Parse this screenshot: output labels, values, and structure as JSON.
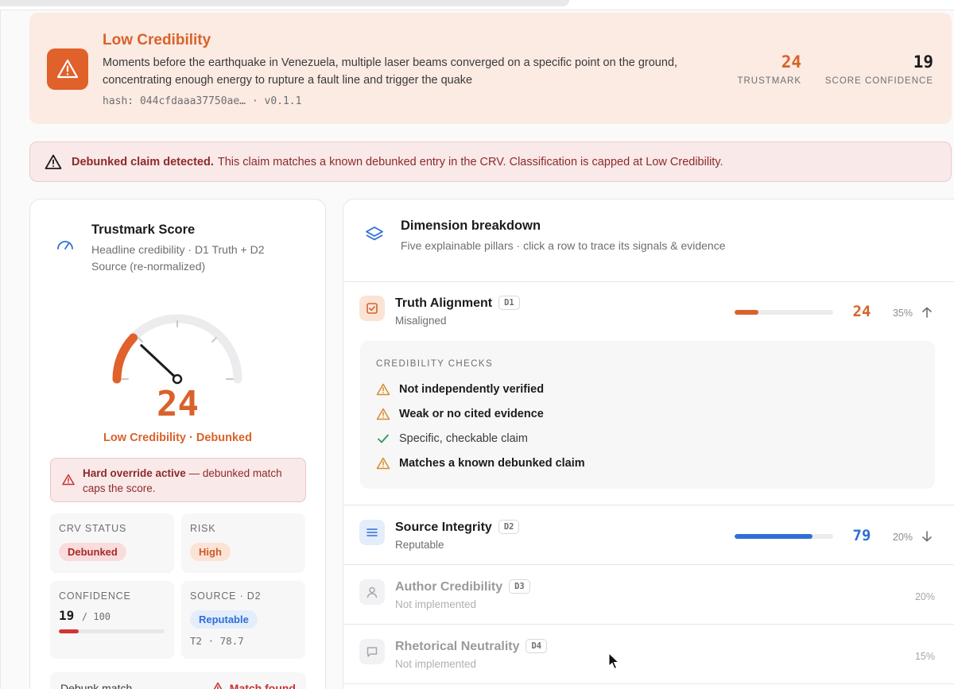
{
  "header": {
    "classification": "Low Credibility",
    "claim_text": "Moments before the earthquake in Venezuela, multiple laser beams converged on a specific point on the ground, concentrating enough energy to rupture a fault line and trigger the quake",
    "hash_line": "hash: 044cfdaaa37750ae… · v0.1.1",
    "trustmark_value": "24",
    "trustmark_label": "TRUSTMARK",
    "confidence_value": "19",
    "confidence_label": "SCORE CONFIDENCE"
  },
  "banner": {
    "bold": "Debunked claim detected.",
    "text": "This claim matches a known debunked entry in the CRV. Classification is capped at Low Credibility."
  },
  "score_panel": {
    "title": "Trustmark Score",
    "subtitle": "Headline credibility · D1 Truth + D2 Source (re-normalized)",
    "score": "24",
    "score_fraction": 0.24,
    "caption": "Low Credibility · Debunked",
    "override_bold": "Hard override active",
    "override_text": " — debunked match caps the score.",
    "crv_label": "CRV STATUS",
    "crv_value": "Debunked",
    "risk_label": "RISK",
    "risk_value": "High",
    "confidence_label": "CONFIDENCE",
    "confidence_value": "19",
    "confidence_denominator": "/ 100",
    "confidence_fraction": 0.19,
    "source_label": "SOURCE · D2",
    "source_value": "Reputable",
    "source_tier": "T2 · 78.7",
    "debunk_label": "Debunk match",
    "debunk_value": "Match found"
  },
  "dimensions": {
    "title": "Dimension breakdown",
    "subtitle": "Five explainable pillars · click a row to trace its signals & evidence",
    "checks_heading": "CREDIBILITY CHECKS",
    "checks": [
      {
        "label": "Not independently verified",
        "status": "warn"
      },
      {
        "label": "Weak or no cited evidence",
        "status": "warn"
      },
      {
        "label": "Specific, checkable claim",
        "status": "ok"
      },
      {
        "label": "Matches a known debunked claim",
        "status": "warn"
      }
    ],
    "rows": [
      {
        "name": "Truth Alignment",
        "code": "D1",
        "state": "Misaligned",
        "score": "24",
        "fraction": 0.24,
        "weight": "35%",
        "color": "#d9622b",
        "expanded": true
      },
      {
        "name": "Source Integrity",
        "code": "D2",
        "state": "Reputable",
        "score": "79",
        "fraction": 0.79,
        "weight": "20%",
        "color": "#2f6fd6",
        "expanded": false
      },
      {
        "name": "Author Credibility",
        "code": "D3",
        "state": "Not implemented",
        "weight": "20%"
      },
      {
        "name": "Rhetorical Neutrality",
        "code": "D4",
        "state": "Not implemented",
        "weight": "15%"
      }
    ]
  },
  "colors": {
    "accent_orange": "#d9622b",
    "danger_red": "#c83232",
    "blue": "#2f6fd6"
  }
}
